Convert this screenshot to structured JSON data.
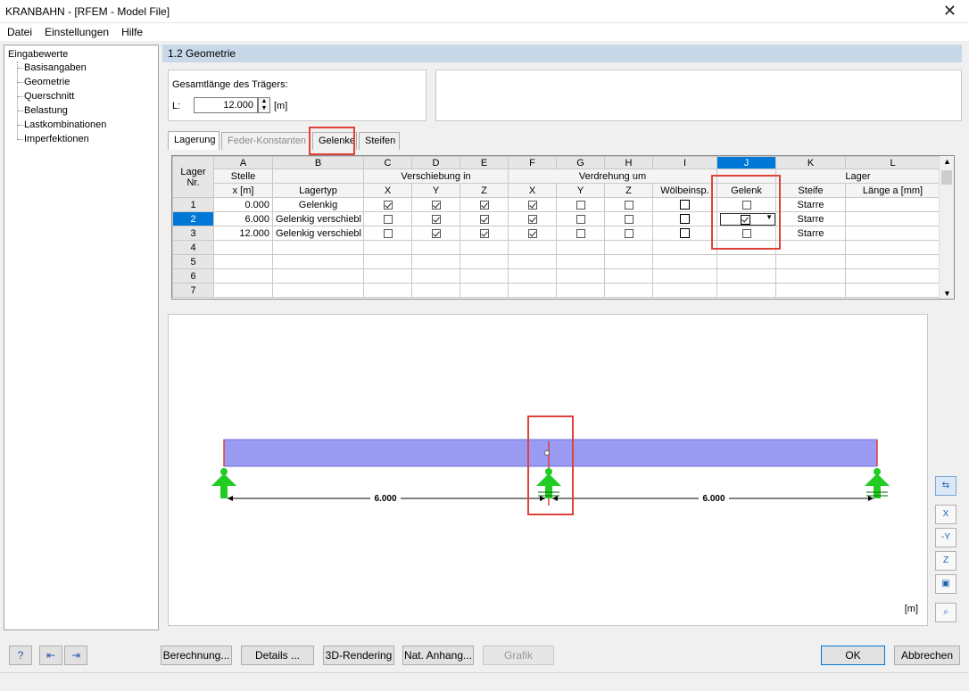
{
  "window": {
    "title": "KRANBAHN - [RFEM - Model File]",
    "close_glyph": "✕"
  },
  "menu": [
    "Datei",
    "Einstellungen",
    "Hilfe"
  ],
  "nav": {
    "root": "Eingabewerte",
    "items": [
      "Basisangaben",
      "Geometrie",
      "Querschnitt",
      "Belastung",
      "Lastkombinationen",
      "Imperfektionen"
    ]
  },
  "section_title": "1.2 Geometrie",
  "geometry": {
    "label": "Gesamtlänge des Trägers:",
    "symbol": "L:",
    "value": "12.000",
    "unit": "[m]"
  },
  "tabs": [
    {
      "label": "Lagerung",
      "state": "active"
    },
    {
      "label": "Feder-Konstanten",
      "state": "disabled"
    },
    {
      "label": "Gelenke",
      "state": "normal"
    },
    {
      "label": "Steifen",
      "state": "normal"
    }
  ],
  "table": {
    "col_letters": [
      "A",
      "B",
      "C",
      "D",
      "E",
      "F",
      "G",
      "H",
      "I",
      "J",
      "K",
      "L"
    ],
    "corner_top": "Lager",
    "corner_bottom": "Nr.",
    "head1": {
      "stelle": "Stelle",
      "verschiebung": "Verschiebung in",
      "verdrehung": "Verdrehung um",
      "lager": "Lager"
    },
    "head2": {
      "stelle": "x [m]",
      "lagertyp": "Lagertyp",
      "vx": "X",
      "vy": "Y",
      "vz": "Z",
      "rx": "X",
      "ry": "Y",
      "rz": "Z",
      "woelb": "Wölbeinsp.",
      "gelenk": "Gelenk",
      "steife": "Steife",
      "laenge": "Länge a [mm]"
    },
    "rows": [
      {
        "nr": "1",
        "x": "0.000",
        "typ": "Gelenkig",
        "vx": true,
        "vy": true,
        "vz": true,
        "rx": true,
        "ry": false,
        "rz": false,
        "woelb": false,
        "gelenk": false,
        "steife": "Starre",
        "laenge": ""
      },
      {
        "nr": "2",
        "x": "6.000",
        "typ": "Gelenkig verschiebl",
        "vx": false,
        "vy": true,
        "vz": true,
        "rx": true,
        "ry": false,
        "rz": false,
        "woelb": false,
        "gelenk": true,
        "steife": "Starre",
        "laenge": ""
      },
      {
        "nr": "3",
        "x": "12.000",
        "typ": "Gelenkig verschiebl",
        "vx": false,
        "vy": true,
        "vz": true,
        "rx": true,
        "ry": false,
        "rz": false,
        "woelb": false,
        "gelenk": false,
        "steife": "Starre",
        "laenge": ""
      },
      {
        "nr": "4"
      },
      {
        "nr": "5"
      },
      {
        "nr": "6"
      },
      {
        "nr": "7"
      }
    ],
    "selected_row": "2",
    "selected_col": "J"
  },
  "graphic": {
    "dim_left": "6.000",
    "dim_right": "6.000",
    "unit": "[m]",
    "beam_color": "#9a9af2",
    "support_color": "#22cc22",
    "highlight_color": "#e0413a"
  },
  "view_tools": [
    "x-view-icon",
    "view-x-icon",
    "view-y-icon",
    "view-z-icon",
    "iso-view-icon",
    "zoom-reset-icon"
  ],
  "buttons": {
    "berechnung": "Berechnung...",
    "details": "Details ...",
    "rendering": "3D-Rendering",
    "anhang": "Nat. Anhang...",
    "grafik": "Grafik",
    "ok": "OK",
    "abbrechen": "Abbrechen"
  }
}
